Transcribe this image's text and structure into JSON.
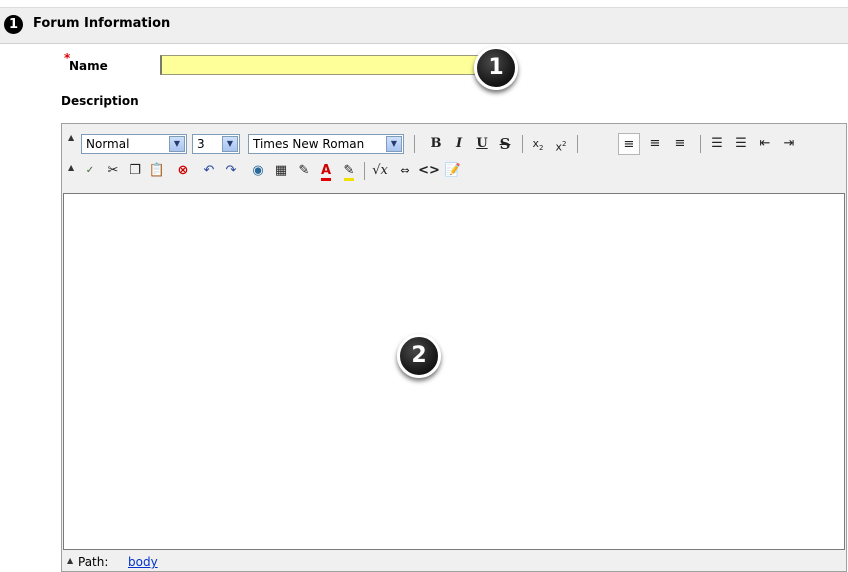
{
  "section": {
    "step_number": "1",
    "title": "Forum Information"
  },
  "name_field": {
    "required_marker": "*",
    "label": "Name",
    "value": ""
  },
  "description": {
    "label": "Description"
  },
  "editor": {
    "style_select": "Normal",
    "size_select": "3",
    "font_select": "Times New Roman",
    "status_path_label": "Path:",
    "status_path_value": "body"
  },
  "callouts": [
    {
      "label": "1"
    },
    {
      "label": "2"
    }
  ],
  "colors": {
    "name_input_bg": "#ffff99",
    "required_star": "#dd0000",
    "header_bar_bg": "#efefef",
    "toolbar_bg": "#f0f0f0",
    "path_link": "#0033cc",
    "font_color_underline": "#e00000",
    "highlight_color_underline": "#f0e000"
  },
  "icons": [
    "bold-icon",
    "italic-icon",
    "underline-icon",
    "strikethrough-icon",
    "subscript-icon",
    "superscript-icon",
    "align-left-icon",
    "align-center-icon",
    "align-right-icon",
    "ordered-list-icon",
    "unordered-list-icon",
    "outdent-icon",
    "indent-icon",
    "spellcheck-icon",
    "cut-icon",
    "copy-icon",
    "paste-icon",
    "remove-format-icon",
    "undo-icon",
    "redo-icon",
    "link-icon",
    "table-icon",
    "pencil-icon",
    "font-color-icon",
    "highlight-icon",
    "equation-icon",
    "embed-icon",
    "html-source-icon",
    "preview-icon"
  ]
}
